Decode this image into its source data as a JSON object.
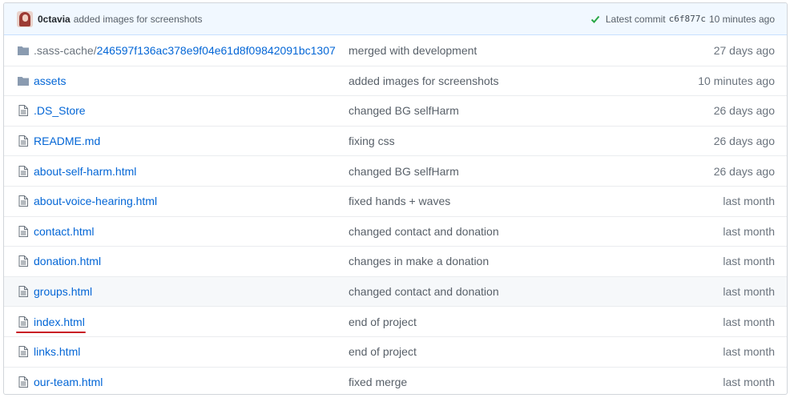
{
  "commit": {
    "author": "0ctavia",
    "message": "added images for screenshots",
    "latest_label": "Latest commit",
    "sha": "c6f877c",
    "time": "10 minutes ago",
    "status_color": "#28a745"
  },
  "files": [
    {
      "type": "folder",
      "prefix": ".sass-cache/",
      "name": "246597f136ac378e9f04e61d8f09842091bc1307",
      "message": "merged with development",
      "age": "27 days ago"
    },
    {
      "type": "folder",
      "prefix": "",
      "name": "assets",
      "message": "added images for screenshots",
      "age": "10 minutes ago"
    },
    {
      "type": "file",
      "prefix": "",
      "name": ".DS_Store",
      "message": "changed BG selfHarm",
      "age": "26 days ago"
    },
    {
      "type": "file",
      "prefix": "",
      "name": "README.md",
      "message": "fixing css",
      "age": "26 days ago"
    },
    {
      "type": "file",
      "prefix": "",
      "name": "about-self-harm.html",
      "message": "changed BG selfHarm",
      "age": "26 days ago"
    },
    {
      "type": "file",
      "prefix": "",
      "name": "about-voice-hearing.html",
      "message": "fixed hands + waves",
      "age": "last month"
    },
    {
      "type": "file",
      "prefix": "",
      "name": "contact.html",
      "message": "changed contact and donation",
      "age": "last month"
    },
    {
      "type": "file",
      "prefix": "",
      "name": "donation.html",
      "message": "changes in make a donation",
      "age": "last month"
    },
    {
      "type": "file",
      "prefix": "",
      "name": "groups.html",
      "message": "changed contact and donation",
      "age": "last month"
    },
    {
      "type": "file",
      "prefix": "",
      "name": "index.html",
      "message": "end of project",
      "age": "last month"
    },
    {
      "type": "file",
      "prefix": "",
      "name": "links.html",
      "message": "end of project",
      "age": "last month"
    },
    {
      "type": "file",
      "prefix": "",
      "name": "our-team.html",
      "message": "fixed merge",
      "age": "last month"
    }
  ],
  "hovered_file": "groups.html",
  "underlined_file": "index.html"
}
